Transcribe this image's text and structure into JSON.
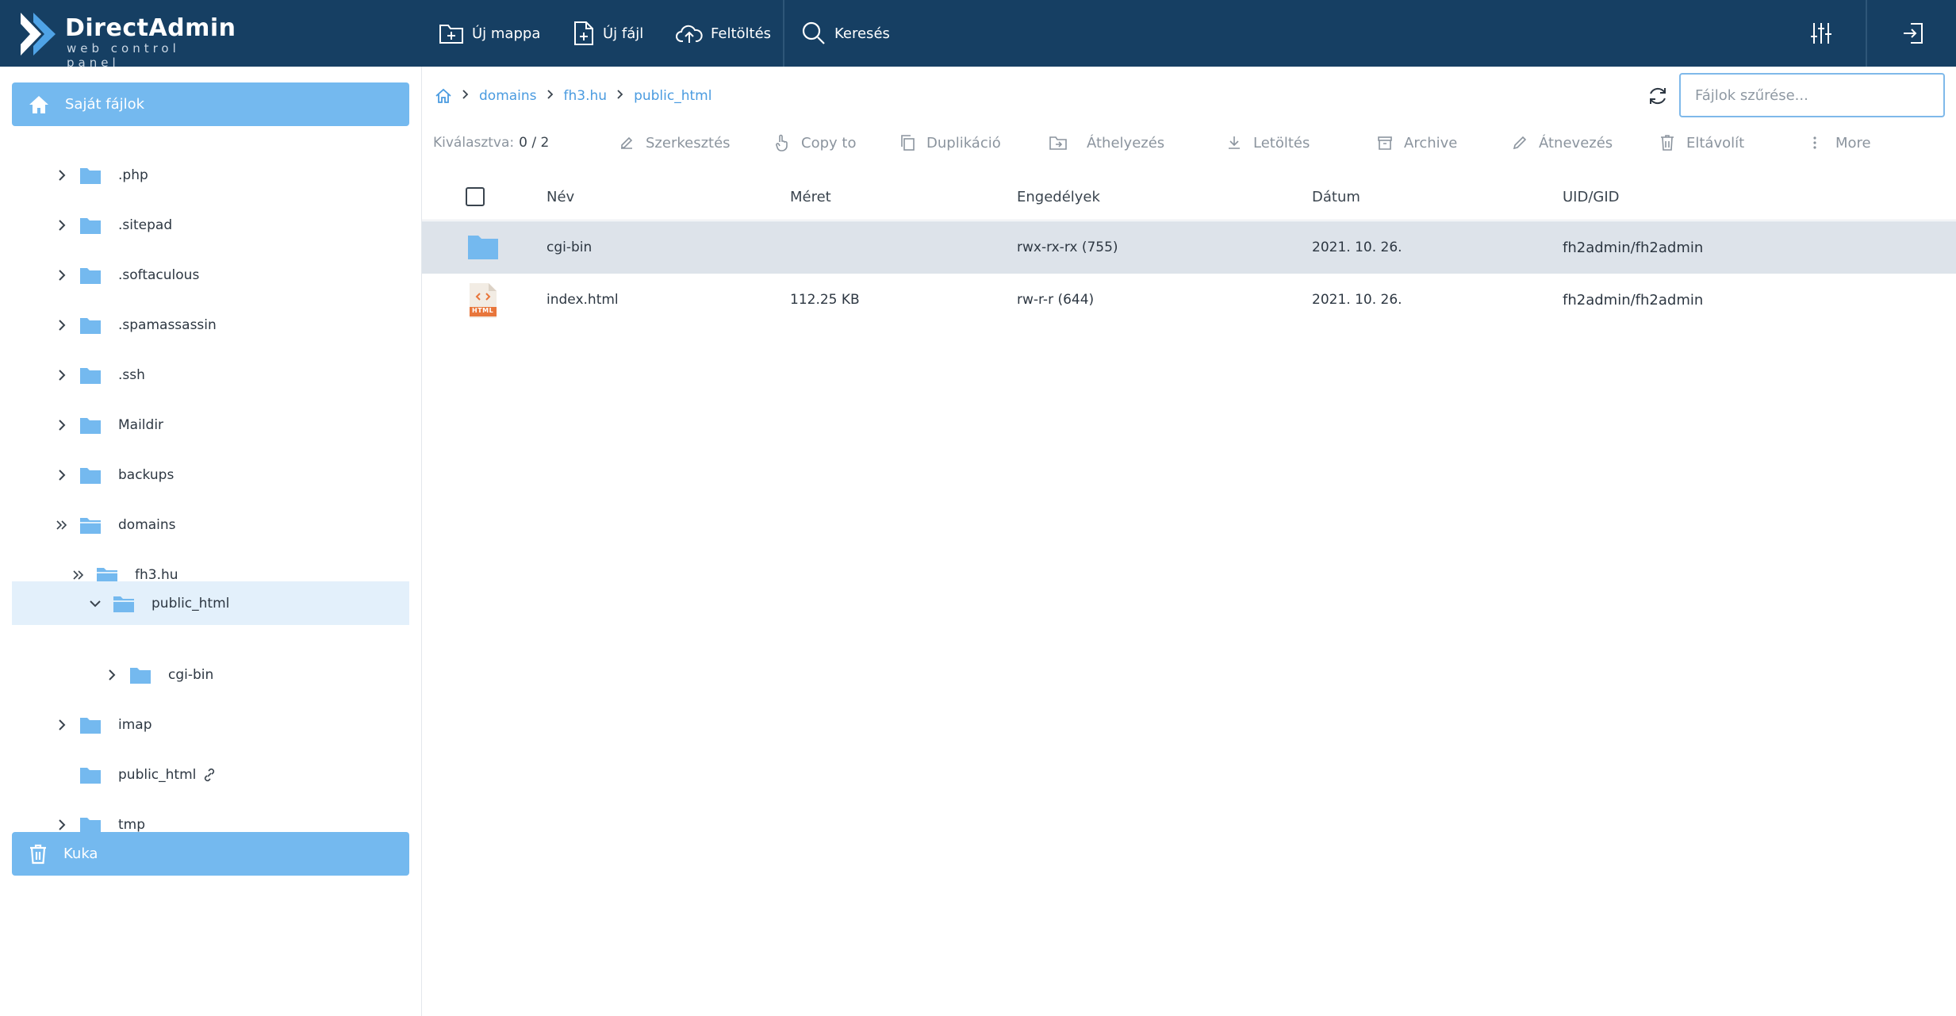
{
  "app": {
    "brand": "DirectAdmin",
    "tagline": "web control panel"
  },
  "toolbar": {
    "new_folder": "Új mappa",
    "new_file": "Új fájl",
    "upload": "Feltöltés",
    "search": "Keresés"
  },
  "sidebar": {
    "my_files": "Saját fájlok",
    "trash": "Kuka",
    "items": [
      {
        "label": ".php"
      },
      {
        "label": ".sitepad"
      },
      {
        "label": ".softaculous"
      },
      {
        "label": ".spamassassin"
      },
      {
        "label": ".ssh"
      },
      {
        "label": "Maildir"
      },
      {
        "label": "backups"
      },
      {
        "label": "domains"
      },
      {
        "label": "fh3.hu"
      },
      {
        "label": "public_html"
      },
      {
        "label": "cgi-bin"
      },
      {
        "label": "imap"
      },
      {
        "label": "public_html"
      },
      {
        "label": "tmp"
      }
    ]
  },
  "breadcrumb": {
    "items": [
      "domains",
      "fh3.hu",
      "public_html"
    ]
  },
  "filter": {
    "placeholder": "Fájlok szűrése..."
  },
  "actions": {
    "selected_label": "Kiválasztva:",
    "selected_value": "0 / 2",
    "edit": "Szerkesztés",
    "copy_to": "Copy to",
    "duplicate": "Duplikáció",
    "move": "Áthelyezés",
    "download": "Letöltés",
    "archive": "Archive",
    "rename": "Átnevezés",
    "remove": "Eltávolít",
    "more": "More"
  },
  "table": {
    "columns": [
      "Név",
      "Méret",
      "Engedélyek",
      "Dátum",
      "UID/GID"
    ],
    "rows": [
      {
        "name": "cgi-bin",
        "size": "",
        "perms": "rwx-rx-rx (755)",
        "date": "2021. 10. 26.",
        "owner": "fh2admin/fh2admin",
        "type": "folder-icon"
      },
      {
        "name": "index.html",
        "size": "112.25 KB",
        "perms": "rw-r-r (644)",
        "date": "2021. 10. 26.",
        "owner": "fh2admin/fh2admin",
        "type": "html-file-icon",
        "badge": "HTML"
      }
    ]
  },
  "colors": {
    "topbar": "#163f63",
    "accent": "#74b9ef",
    "link": "#4a9be0",
    "folder": "#74b9ef",
    "html_badge": "#e8763b"
  }
}
